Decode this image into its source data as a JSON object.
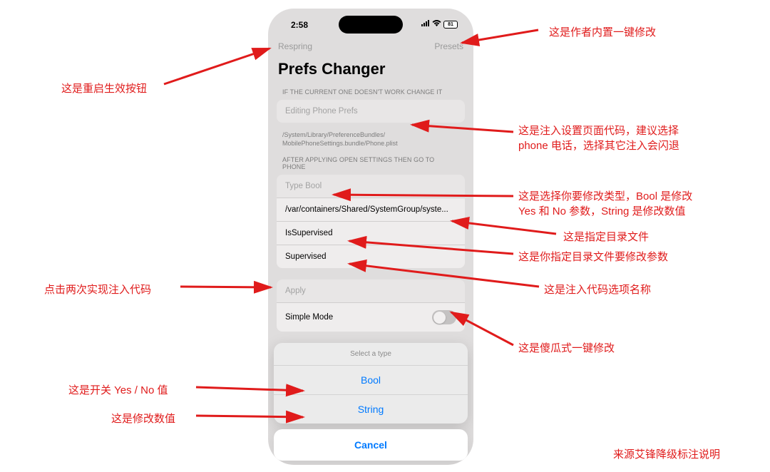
{
  "status": {
    "time": "2:58",
    "battery": "81"
  },
  "nav": {
    "left": "Respring",
    "right": "Presets"
  },
  "title": "Prefs Changer",
  "section1_label": "IF THE CURRENT ONE DOESN'T WORK CHANGE IT",
  "editing_placeholder": "Editing Phone Prefs",
  "plist_path": "/System/Library/PreferenceBundles/\nMobilePhoneSettings.bundle/Phone.plist",
  "section2_label": "AFTER APPLYING OPEN SETTINGS THEN GO TO PHONE",
  "type_bool": "Type Bool",
  "container_path": "/var/containers/Shared/SystemGroup/syste...",
  "is_supervised": "IsSupervised",
  "supervised": "Supervised",
  "apply": "Apply",
  "simple_mode": "Simple Mode",
  "sheet": {
    "title": "Select a type",
    "option1": "Bool",
    "option2": "String",
    "cancel": "Cancel"
  },
  "annotations": {
    "respring": "这是重启生效按钮",
    "presets": "这是作者内置一键修改",
    "editing": "这是注入设置页面代码，建议选择\nphone 电话，选择其它注入会闪退",
    "typebool": "这是选择你要修改类型，Bool 是修改\nYes 和 No 参数，String 是修改数值",
    "container": "这是指定目录文件",
    "issupervised": "这是你指定目录文件要修改参数",
    "supervised": "这是注入代码选项名称",
    "apply": "点击两次实现注入代码",
    "simple": "这是傻瓜式一键修改",
    "bool": "这是开关 Yes / No 值",
    "string": "这是修改数值",
    "source": "来源艾锋降级标注说明"
  }
}
